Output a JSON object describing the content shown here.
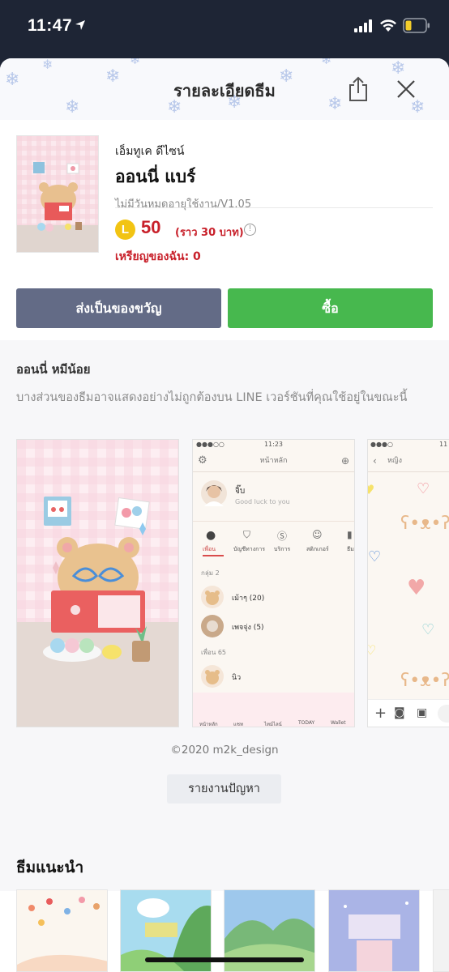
{
  "status_bar": {
    "time": "11:47"
  },
  "header": {
    "title": "รายละเอียดธีม"
  },
  "product": {
    "author": "เอ็มทูเค ดีไซน์",
    "title": "ออนนี่ แบร์",
    "validity": "ไม่มีวันหมดอายุใช้งาน/V1.05",
    "coin_letter": "L",
    "price": "50",
    "approx_price": "(ราว  30 บาท)",
    "info_glyph": "!",
    "my_coins": "เหรียญของฉัน: 0"
  },
  "buttons": {
    "gift": "ส่งเป็นของขวัญ",
    "buy": "ซื้อ"
  },
  "description": {
    "heading": "ออนนี่ หมีน้อย",
    "notice": "บางส่วนของธีมอาจแสดงอย่างไม่ถูกต้องบน LINE เวอร์ชันที่คุณใช้อยู่ในขณะนี้"
  },
  "preview2": {
    "time": "11:23",
    "title": "หน้าหลัก",
    "profile_name": "จิ๊บ",
    "profile_status": "Good luck to you",
    "tabs": [
      "เพื่อน",
      "บัญชีทางการ",
      "บริการ",
      "สติกเกอร์",
      "ธีม"
    ],
    "group_header": "กลุ่ม 2",
    "groups": [
      "เม้าๆ (20)",
      "เพจจุ่ง (5)"
    ],
    "friend_header": "เพื่อน 65",
    "friends": [
      "นิว"
    ],
    "bottom_tabs": [
      "หน้าหลัก",
      "แชท",
      "ไทม์ไลน์",
      "TODAY",
      "Wallet"
    ]
  },
  "preview3": {
    "time": "11",
    "title": "หญิง"
  },
  "copyright": "©2020 m2k_design",
  "report_button": "รายงานปัญหา",
  "recommend": {
    "heading": "ธีมแนะนำ"
  },
  "colors": {
    "buy": "#47b84e",
    "gift": "#636b86",
    "price": "#c8202a",
    "coin": "#f2c413"
  }
}
